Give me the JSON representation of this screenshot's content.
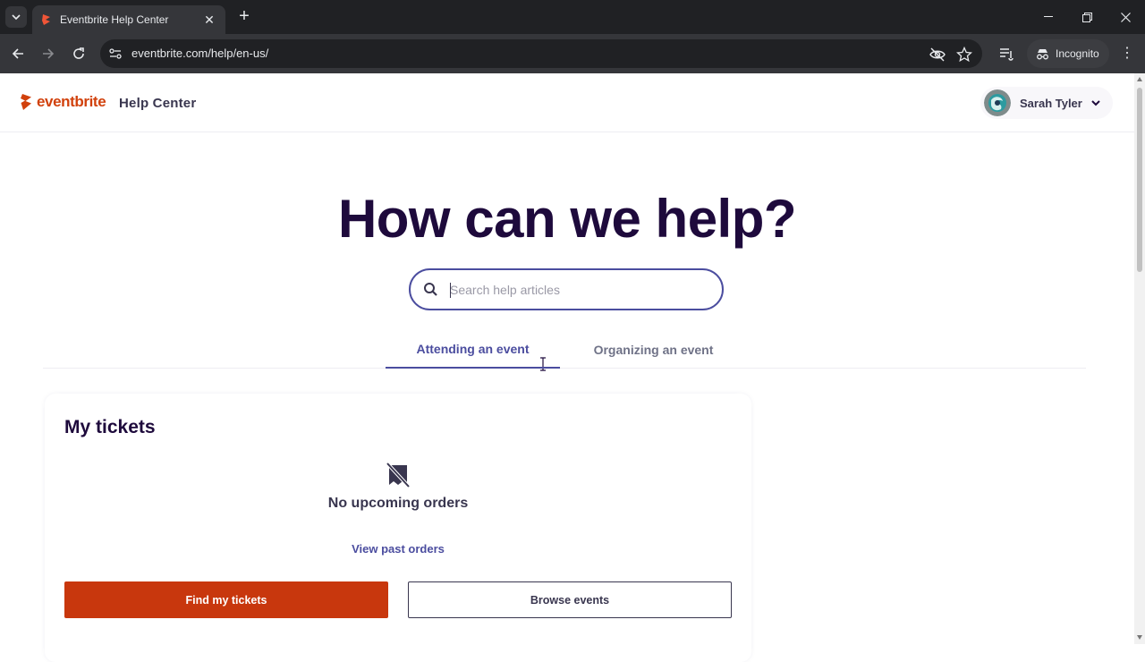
{
  "browser": {
    "tab_title": "Eventbrite Help Center",
    "url": "eventbrite.com/help/en-us/",
    "incognito_label": "Incognito"
  },
  "header": {
    "logo_text": "eventbrite",
    "section_title": "Help Center",
    "user_name": "Sarah Tyler"
  },
  "hero": {
    "title": "How can we help?",
    "search_placeholder": "Search help articles"
  },
  "tabs": [
    {
      "label": "Attending an event",
      "active": true
    },
    {
      "label": "Organizing an event",
      "active": false
    }
  ],
  "tickets_card": {
    "title": "My tickets",
    "empty_message": "No upcoming orders",
    "past_orders_link": "View past orders",
    "primary_button": "Find my tickets",
    "secondary_button": "Browse events"
  },
  "colors": {
    "brand": "#d1410c",
    "heading": "#1e0a3c",
    "accent": "#4b4d9f",
    "primary_button": "#c8370d"
  }
}
